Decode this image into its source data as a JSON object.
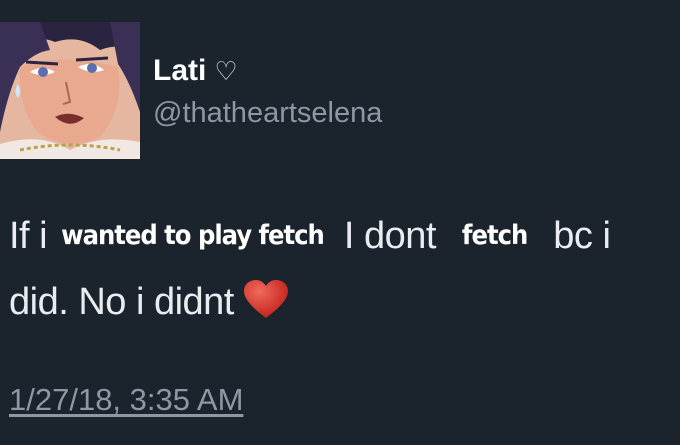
{
  "user": {
    "display_name": "Lati",
    "name_symbol": "♡",
    "handle": "@thatheartselena",
    "avatar_icon": "anime-character-avatar"
  },
  "tweet": {
    "line1": {
      "part1": "If i",
      "edit1": "wanted to play fetch",
      "part2": "I dont",
      "edit2": "fetch",
      "part3": "bc i"
    },
    "line2": {
      "part1": "did. No i didnt",
      "emoji": "red-heart-icon"
    },
    "timestamp": "1/27/18, 3:35 AM"
  },
  "colors": {
    "background": "#1b232d",
    "text": "#e9edf0",
    "muted": "#8c98a4",
    "heart": "#d9302f"
  }
}
